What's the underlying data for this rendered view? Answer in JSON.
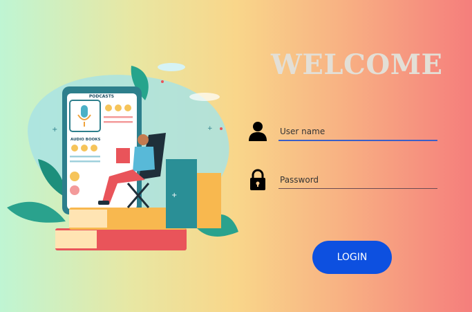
{
  "welcome": {
    "title": "WELCOME"
  },
  "illustration": {
    "podcasts_label": "PODCASTS",
    "audio_books_label": "AUDIO BOOKS"
  },
  "form": {
    "username": {
      "placeholder": "User name",
      "value": ""
    },
    "password": {
      "placeholder": "Password",
      "value": ""
    },
    "login_label": "LOGIN"
  },
  "colors": {
    "button": "#0d50e0",
    "welcome_text": "#e3dfd6",
    "gradient_start": "#bff5d3",
    "gradient_end": "#f57e7c"
  },
  "icons": [
    "user-icon",
    "lock-icon"
  ]
}
